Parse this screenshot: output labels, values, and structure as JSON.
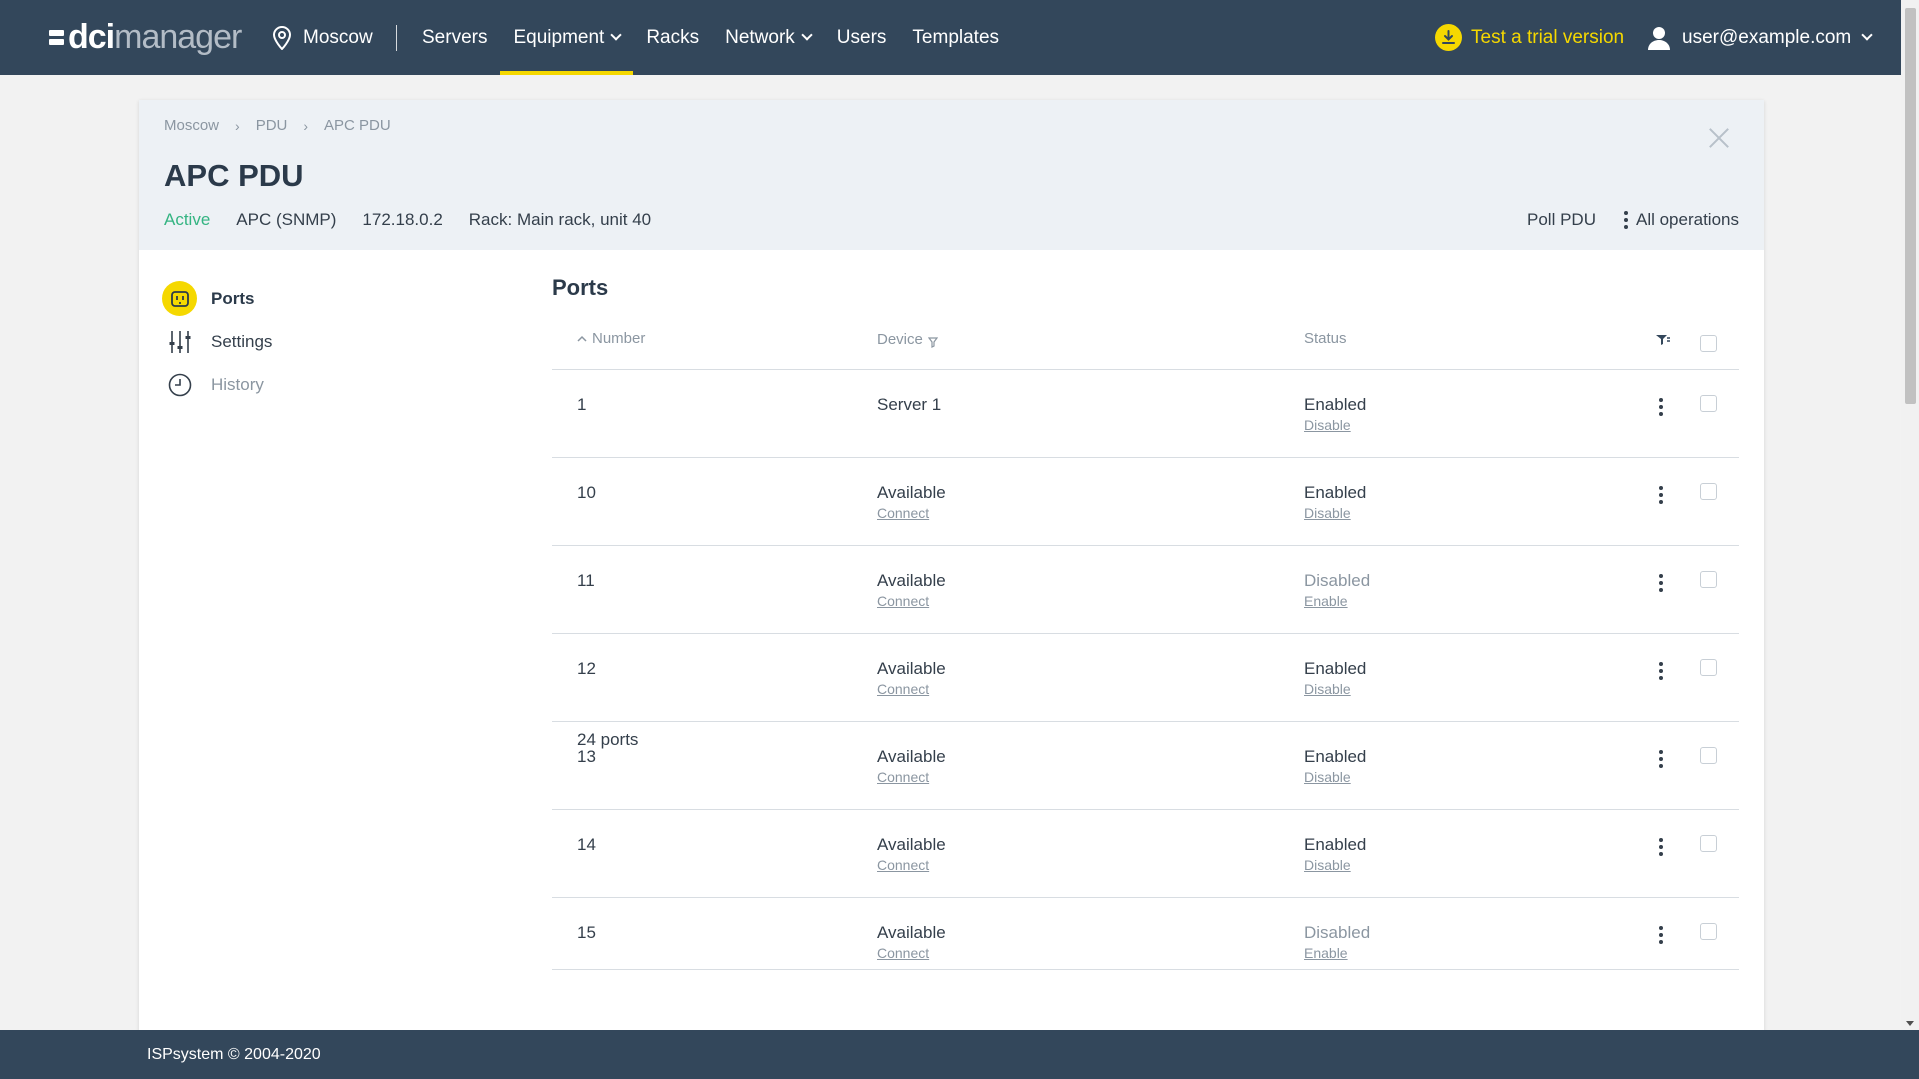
{
  "topbar": {
    "logo_main": "dci",
    "logo_rest": "manager",
    "location": "Moscow",
    "nav": [
      {
        "label": "Servers",
        "dropdown": false,
        "active": false
      },
      {
        "label": "Equipment",
        "dropdown": true,
        "active": true
      },
      {
        "label": "Racks",
        "dropdown": false,
        "active": false
      },
      {
        "label": "Network",
        "dropdown": true,
        "active": false
      },
      {
        "label": "Users",
        "dropdown": false,
        "active": false
      },
      {
        "label": "Templates",
        "dropdown": false,
        "active": false
      }
    ],
    "trial": "Test a trial version",
    "user": "user@example.com"
  },
  "breadcrumb": [
    "Moscow",
    "PDU",
    "APC PDU"
  ],
  "device": {
    "title": "APC PDU",
    "status": "Active",
    "model": "APC (SNMP)",
    "ip": "172.18.0.2",
    "rack": "Rack: Main rack, unit 40"
  },
  "actions": {
    "poll": "Poll PDU",
    "all_operations": "All operations"
  },
  "sidebar": [
    {
      "label": "Ports",
      "icon": "port-icon",
      "active": true
    },
    {
      "label": "Settings",
      "icon": "sliders-icon",
      "active": false
    },
    {
      "label": "History",
      "icon": "clock-icon",
      "active": false
    }
  ],
  "ports": {
    "title": "Ports",
    "columns": {
      "number": "Number",
      "device": "Device",
      "status": "Status"
    },
    "rows": [
      {
        "number": "1",
        "device": "Server 1",
        "device_action": "",
        "status": "Enabled",
        "status_action": "Disable"
      },
      {
        "number": "10",
        "device": "Available",
        "device_action": "Connect",
        "status": "Enabled",
        "status_action": "Disable"
      },
      {
        "number": "11",
        "device": "Available",
        "device_action": "Connect",
        "status": "Disabled",
        "status_action": "Enable"
      },
      {
        "number": "12",
        "device": "Available",
        "device_action": "Connect",
        "status": "Enabled",
        "status_action": "Disable"
      },
      {
        "number": "13",
        "device": "Available",
        "device_action": "Connect",
        "status": "Enabled",
        "status_action": "Disable"
      },
      {
        "number": "14",
        "device": "Available",
        "device_action": "Connect",
        "status": "Enabled",
        "status_action": "Disable"
      },
      {
        "number": "15",
        "device": "Available",
        "device_action": "Connect",
        "status": "Disabled",
        "status_action": "Enable"
      }
    ],
    "count": "24 ports"
  },
  "footer": "ISPsystem © 2004-2020",
  "colors": {
    "topbar": "#33475b",
    "accent": "#f5d800",
    "active_status": "#34b482"
  }
}
